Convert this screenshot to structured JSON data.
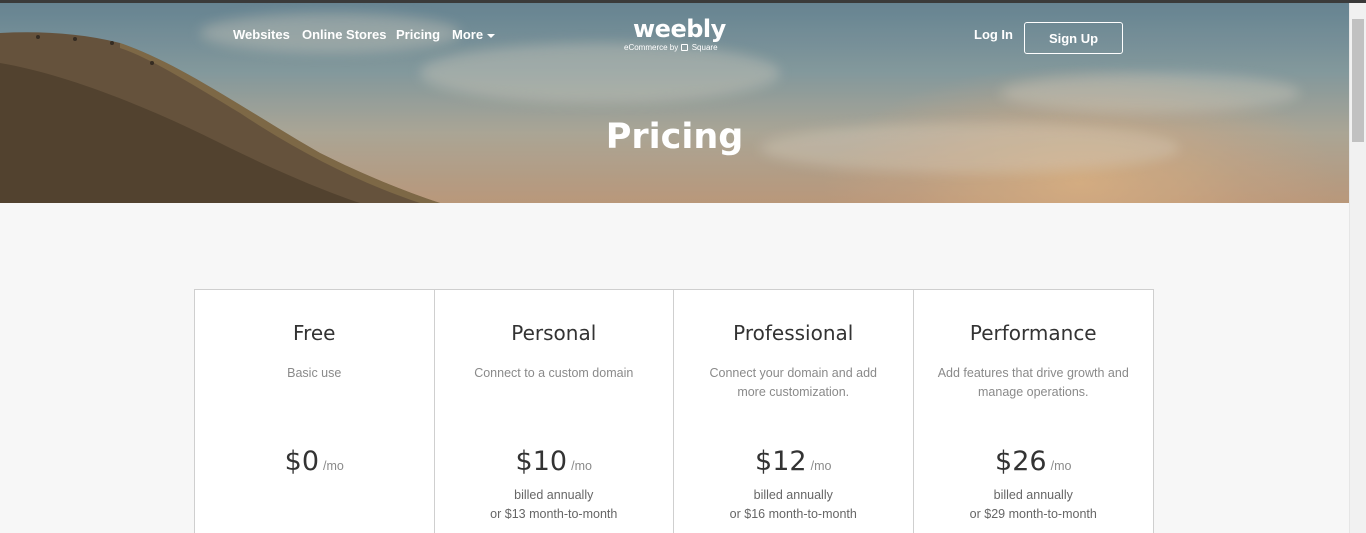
{
  "header": {
    "nav": [
      "Websites",
      "Online Stores",
      "Pricing",
      "More"
    ],
    "logo": {
      "word": "weebly",
      "sub_prefix": "eCommerce by",
      "sub_brand": "Square"
    },
    "login": "Log In",
    "signup": "Sign Up"
  },
  "hero": {
    "title": "Pricing"
  },
  "plans": [
    {
      "name": "Free",
      "desc": "Basic use",
      "price": "$0",
      "per": "/mo",
      "billed": "",
      "monthly": ""
    },
    {
      "name": "Personal",
      "desc": "Connect to a custom domain",
      "price": "$10",
      "per": "/mo",
      "billed": "billed annually",
      "monthly": "or $13 month-to-month"
    },
    {
      "name": "Professional",
      "desc": "Connect your domain and add more customization.",
      "price": "$12",
      "per": "/mo",
      "billed": "billed annually",
      "monthly": "or $16 month-to-month"
    },
    {
      "name": "Performance",
      "desc": "Add features that drive growth and manage operations.",
      "price": "$26",
      "per": "/mo",
      "billed": "billed annually",
      "monthly": "or $29 month-to-month"
    }
  ],
  "icons": {
    "more_menu": "chevron-down-icon",
    "square_logo": "square-logo-icon"
  },
  "colors": {
    "accent": "#ffffff",
    "background": "#f7f7f7",
    "border": "#cfcfcf",
    "text": "#333333",
    "muted": "#8a8a8a"
  }
}
